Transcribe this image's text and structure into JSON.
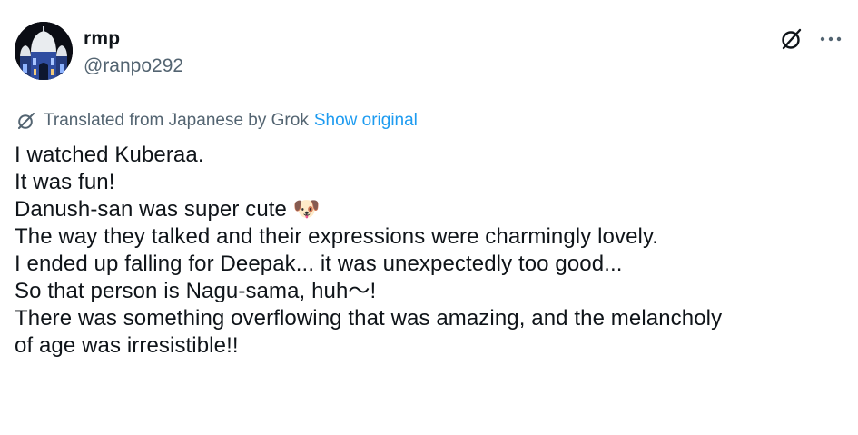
{
  "user": {
    "display_name": "rmp",
    "handle": "@ranpo292"
  },
  "actions": {
    "grok_icon": "grok-icon",
    "more_icon": "more-icon",
    "more_label": "···"
  },
  "translation": {
    "icon": "grok-icon",
    "label": "Translated from Japanese by Grok",
    "show_original": "Show original"
  },
  "post": {
    "lines": [
      "I watched Kuberaa.",
      "It was fun!",
      "Danush-san was super cute 🐶",
      "The way they talked and their expressions were charmingly lovely.",
      "I ended up falling for Deepak... it was unexpectedly too good...",
      "So that person is Nagu-sama, huh〜!",
      "There was something overflowing that was amazing, and the melancholy",
      "of age was irresistible!!"
    ]
  },
  "colors": {
    "text_primary": "#0f1419",
    "text_secondary": "#536471",
    "link": "#1d9bf0",
    "background": "#ffffff"
  }
}
